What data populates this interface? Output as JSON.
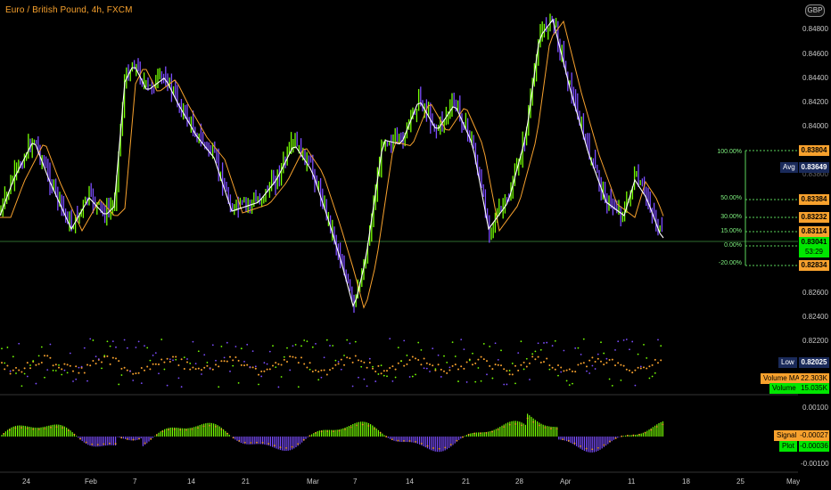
{
  "header": {
    "title": "Euro / British Pound, 4h, FXCM",
    "currency_button": "GBP"
  },
  "colors": {
    "background": "#000000",
    "bull": "#76ff03",
    "bear": "#7c4dff",
    "ma_fast": "#ffffff",
    "ma_slow": "#f7a12d",
    "fib": "#5cd65c",
    "orange_tag": "#f7a12d",
    "green_tag": "#00e600",
    "navy_tag": "#1a2a5a"
  },
  "price_axis": {
    "ticks": [
      "0.84800",
      "0.84600",
      "0.84400",
      "0.84200",
      "0.84000",
      "0.83800",
      "0.82600",
      "0.82400",
      "0.82200",
      "-0.00100"
    ]
  },
  "tags": {
    "p100": "0.83804",
    "avg_label": "Avg",
    "avg": "0.83649",
    "p50": "0.83384",
    "p30": "0.83232",
    "p15": "0.83114",
    "last": "0.83041",
    "countdown": "53:29",
    "pm20": "0.82834",
    "low_label": "Low",
    "low": "0.82025",
    "vol_ma_label": "Volume MA",
    "vol_ma": "22.303K",
    "vol_label": "Volume",
    "vol": "15.035K",
    "macd_top": "0.00100",
    "signal_label": "Signal",
    "signal": "-0.00027",
    "plot_label": "Plot",
    "plot": "-0.00036"
  },
  "fib_levels": [
    "100.00%",
    "50.00%",
    "30.00%",
    "15.00%",
    "0.00%",
    "-20.00%"
  ],
  "time_axis": [
    "24",
    "Feb",
    "7",
    "14",
    "21",
    "Mar",
    "7",
    "14",
    "21",
    "28",
    "Apr",
    "11",
    "18",
    "25",
    "May"
  ]
}
